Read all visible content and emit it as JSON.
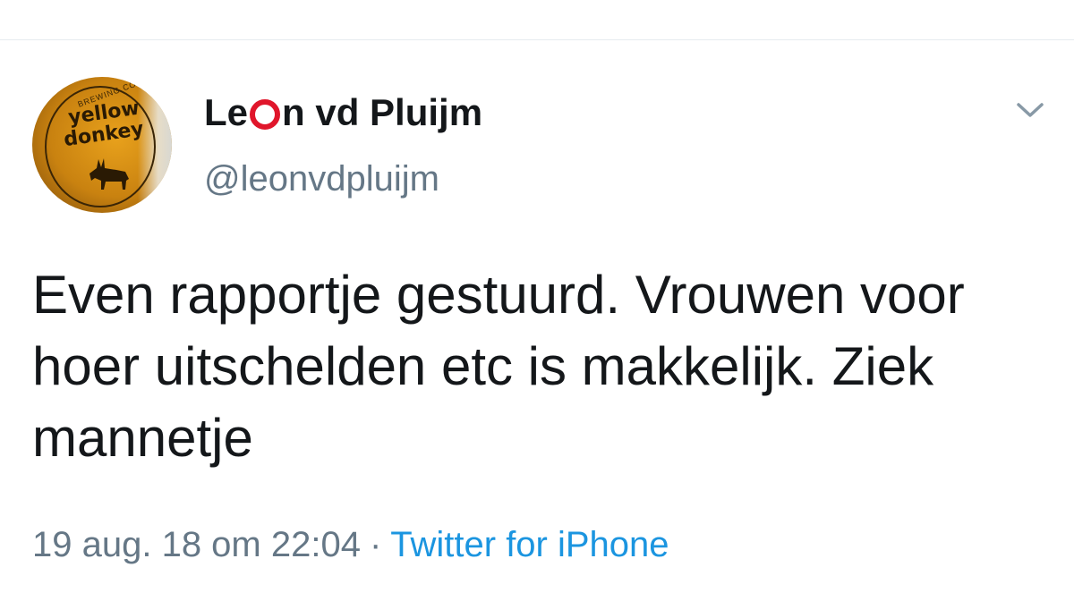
{
  "tweet": {
    "author": {
      "name_before": "Le",
      "name_after": "n vd Pluijm",
      "handle": "@leonvdpluijm",
      "avatar": {
        "label_words": [
          "yellow",
          "donkey"
        ],
        "ring_text": "BREWING COMPANY"
      }
    },
    "text": "Even rapportje gestuurd. Vrouwen voor hoer uitschelden etc is makkelijk. Ziek mannetje",
    "timestamp": "19 aug. 18 om 22:04",
    "separator": "·",
    "source": "Twitter for iPhone"
  },
  "icons": {
    "menu": "chevron-down-icon",
    "name_symbol": "red-ring-icon"
  },
  "colors": {
    "accent_link": "#1b95e0",
    "secondary_text": "#657786",
    "primary_text": "#14171a",
    "ring_red": "#e0162b"
  }
}
